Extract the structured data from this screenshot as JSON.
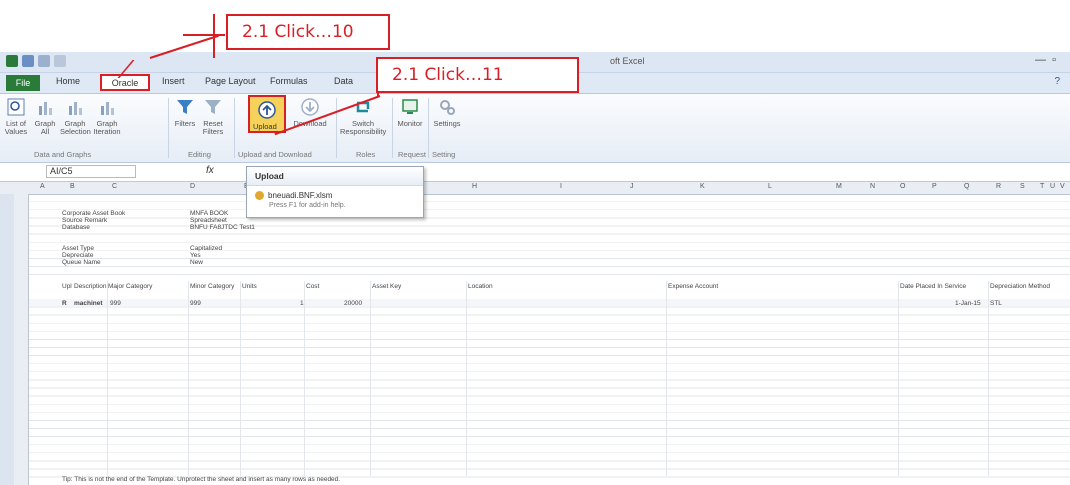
{
  "callouts": {
    "first": "2.1 Click…10",
    "second": "2.1 Click…11"
  },
  "window": {
    "title": "oft Excel"
  },
  "tabs": {
    "file": "File",
    "home": "Home",
    "oracle": "Oracle",
    "insert": "Insert",
    "page_layout": "Page Layout",
    "formulas": "Formulas",
    "data": "Data"
  },
  "ribbon": {
    "list_values": "List of Values",
    "graph_all": "Graph All",
    "graph_selection": "Graph Selection",
    "graph_iteration": "Graph Iteration",
    "filters": "Filters",
    "reset_filters": "Reset Filters",
    "upload": "Upload",
    "download": "Download",
    "switch_responsibility": "Switch Responsibility",
    "monitor": "Monitor",
    "settings": "Settings",
    "group_data_graphs": "Data and Graphs",
    "group_editing": "Editing",
    "group_upload_download": "Upload and Download",
    "group_roles": "Roles",
    "group_request": "Request",
    "group_setting": "Setting"
  },
  "formula_bar": {
    "name_box": "AI/C5",
    "fx": "fx"
  },
  "tooltip": {
    "title": "Upload",
    "item": "bneuadi.BNF.xlsm",
    "help": "Press F1 for add-in help."
  },
  "columns": [
    "A",
    "B",
    "C",
    "D",
    "E",
    "F",
    "G",
    "H",
    "I",
    "J",
    "K",
    "L",
    "M",
    "N",
    "O",
    "P",
    "Q",
    "R",
    "S",
    "T",
    "U",
    "V"
  ],
  "sheet": {
    "meta_labels": [
      "Corporate Asset Book",
      "Source Remark",
      "Database"
    ],
    "meta_values": [
      "MNFA BOOK",
      "Spreadsheet",
      "BNFU FA8JTDC Test1"
    ],
    "asset_labels": [
      "Asset Type",
      "Depreciate",
      "Queue Name"
    ],
    "asset_values": [
      "Capitalized",
      "Yes",
      "New"
    ],
    "headers": [
      "Upl",
      "Description",
      "Major Category",
      "Minor Category",
      "Units",
      "Cost",
      "Asset Key",
      "Location",
      "Expense Account",
      "Date Placed In Service",
      "Depreciation Method"
    ],
    "row": {
      "flag": "R",
      "description": "machinet",
      "major": "999",
      "minor": "999",
      "units": "1",
      "cost": "20000",
      "date": "1-Jan-15",
      "method": "STL"
    },
    "tip": "Tip: This is not the end of the Template. Unprotect the sheet and insert as many rows as needed."
  }
}
